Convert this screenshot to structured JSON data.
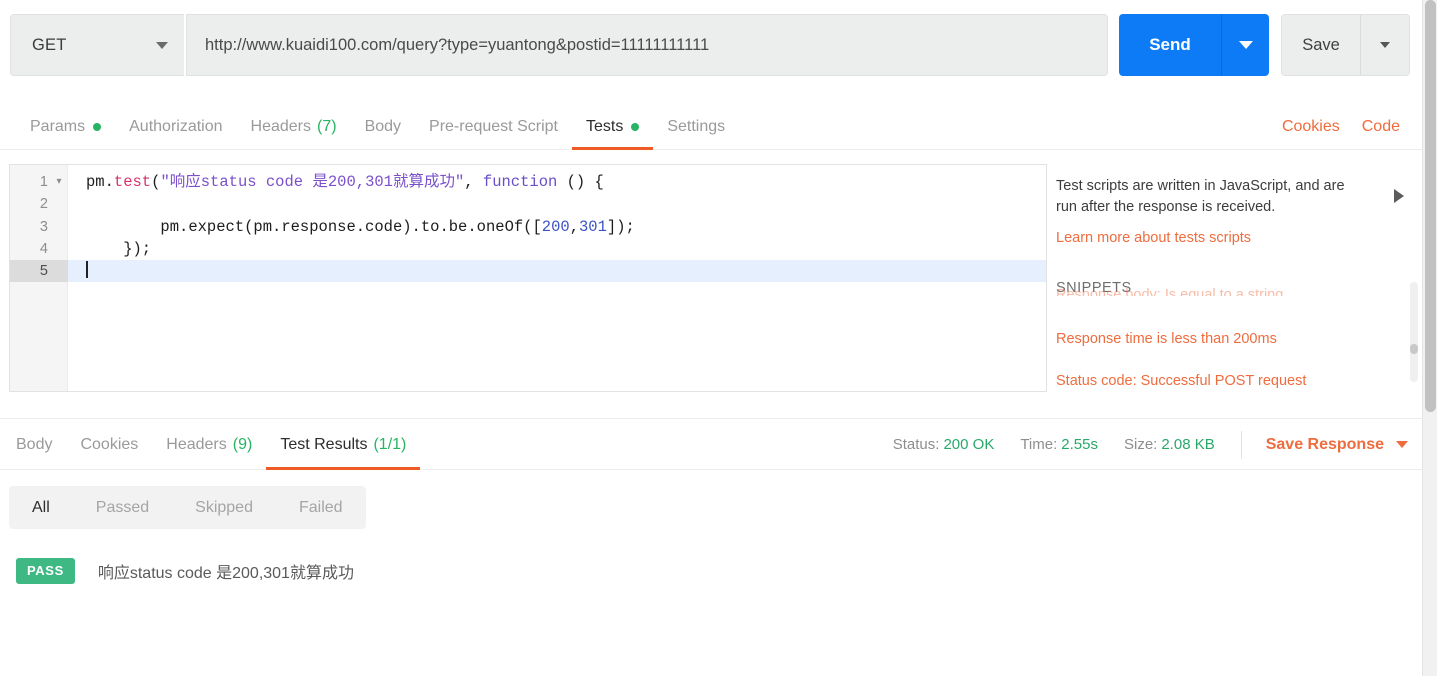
{
  "request": {
    "method": "GET",
    "url": "http://www.kuaidi100.com/query?type=yuantong&postid=11111111111",
    "send_label": "Send",
    "save_label": "Save"
  },
  "request_tabs": [
    {
      "label": "Params",
      "dot": true,
      "count": "",
      "active": false
    },
    {
      "label": "Authorization",
      "dot": false,
      "count": "",
      "active": false
    },
    {
      "label": "Headers",
      "dot": false,
      "count": "(7)",
      "active": false
    },
    {
      "label": "Body",
      "dot": false,
      "count": "",
      "active": false
    },
    {
      "label": "Pre-request Script",
      "dot": false,
      "count": "",
      "active": false
    },
    {
      "label": "Tests",
      "dot": true,
      "count": "",
      "active": true
    },
    {
      "label": "Settings",
      "dot": false,
      "count": "",
      "active": false
    }
  ],
  "tab_actions": {
    "cookies": "Cookies",
    "code": "Code"
  },
  "editor": {
    "lines": [
      {
        "number": "1",
        "fold": "▾",
        "active": false,
        "tokens": [
          {
            "t": "pm.",
            "c": "plain"
          },
          {
            "t": "test",
            "c": "fn"
          },
          {
            "t": "(",
            "c": "plain"
          },
          {
            "t": "\"响应status code 是200,301就算成功\"",
            "c": "str"
          },
          {
            "t": ", ",
            "c": "plain"
          },
          {
            "t": "function",
            "c": "kw"
          },
          {
            "t": " () {",
            "c": "plain"
          }
        ]
      },
      {
        "number": "2",
        "fold": "",
        "active": false,
        "tokens": []
      },
      {
        "number": "3",
        "fold": "",
        "active": false,
        "tokens": [
          {
            "t": "        pm.expect(pm.response.code).to.be.oneOf([",
            "c": "plain"
          },
          {
            "t": "200",
            "c": "num"
          },
          {
            "t": ",",
            "c": "plain"
          },
          {
            "t": "301",
            "c": "num"
          },
          {
            "t": "]);",
            "c": "plain"
          }
        ]
      },
      {
        "number": "4",
        "fold": "",
        "active": false,
        "tokens": [
          {
            "t": "    });",
            "c": "plain"
          }
        ]
      },
      {
        "number": "5",
        "fold": "",
        "active": true,
        "cursor": true,
        "tokens": []
      }
    ]
  },
  "snippets": {
    "description": "Test scripts are written in JavaScript, and are run after the response is received.",
    "learn_more": "Learn more about tests scripts",
    "heading": "SNIPPETS",
    "clipped_item": "Response body: Is equal to a string",
    "items": [
      "Response time is less than 200ms",
      "Status code: Successful POST request"
    ]
  },
  "response_tabs": [
    {
      "label": "Body",
      "count": "",
      "active": false
    },
    {
      "label": "Cookies",
      "count": "",
      "active": false
    },
    {
      "label": "Headers",
      "count": "(9)",
      "active": false
    },
    {
      "label": "Test Results",
      "count": "(1/1)",
      "active": true
    }
  ],
  "response_meta": {
    "status_label": "Status:",
    "status_value": "200 OK",
    "time_label": "Time:",
    "time_value": "2.55s",
    "size_label": "Size:",
    "size_value": "2.08 KB",
    "save_response": "Save Response"
  },
  "result_filters": [
    {
      "label": "All",
      "active": true
    },
    {
      "label": "Passed",
      "active": false
    },
    {
      "label": "Skipped",
      "active": false
    },
    {
      "label": "Failed",
      "active": false
    }
  ],
  "test_results": [
    {
      "status": "PASS",
      "name": "响应status code 是200,301就算成功"
    }
  ],
  "colors": {
    "accent_orange": "#ef5b25",
    "send_blue": "#0d7bf5",
    "pass_green": "#3fb983",
    "status_green": "#2aa86a"
  }
}
